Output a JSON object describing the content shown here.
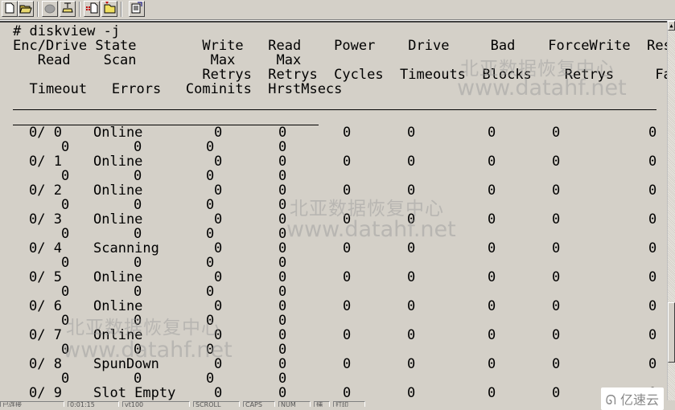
{
  "toolbar": {
    "buttons": [
      {
        "name": "new-icon"
      },
      {
        "name": "open-folder-icon"
      },
      {
        "name": "disconnect-phone-icon"
      },
      {
        "name": "connect-phone-icon"
      },
      {
        "name": "new-session-icon"
      },
      {
        "name": "open-session-icon"
      },
      {
        "name": "properties-icon"
      }
    ]
  },
  "terminal": {
    "command": "# diskview -j",
    "header_lines": [
      "Enc/Drive State        Write   Read    Power    Drive     Bad    ForceWrite  Reset",
      "   Read    Scan         Max     Max",
      "                       Retrys  Retrys  Cycles  Timeouts  Blocks    Retrys     Fail",
      "  Timeout   Errors   Cominits  HrstMsecs"
    ],
    "rows": [
      {
        "drive": "0/ 0",
        "state": "Online",
        "write_max_retrys": "0",
        "read_max_retrys": "0",
        "power_cycles": "0",
        "drive_timeouts": "0",
        "bad_blocks": "0",
        "forcewrite_retrys": "0",
        "reset_fail": "0",
        "read_timeout": "0",
        "scan_errors": "0",
        "cominits": "0",
        "hrstmsecs": "0"
      },
      {
        "drive": "0/ 1",
        "state": "Online",
        "write_max_retrys": "0",
        "read_max_retrys": "0",
        "power_cycles": "0",
        "drive_timeouts": "0",
        "bad_blocks": "0",
        "forcewrite_retrys": "0",
        "reset_fail": "0",
        "read_timeout": "0",
        "scan_errors": "0",
        "cominits": "0",
        "hrstmsecs": "0"
      },
      {
        "drive": "0/ 2",
        "state": "Online",
        "write_max_retrys": "0",
        "read_max_retrys": "0",
        "power_cycles": "0",
        "drive_timeouts": "0",
        "bad_blocks": "0",
        "forcewrite_retrys": "0",
        "reset_fail": "0",
        "read_timeout": "0",
        "scan_errors": "0",
        "cominits": "0",
        "hrstmsecs": "0"
      },
      {
        "drive": "0/ 3",
        "state": "Online",
        "write_max_retrys": "0",
        "read_max_retrys": "0",
        "power_cycles": "0",
        "drive_timeouts": "0",
        "bad_blocks": "0",
        "forcewrite_retrys": "0",
        "reset_fail": "0",
        "read_timeout": "0",
        "scan_errors": "0",
        "cominits": "0",
        "hrstmsecs": "0"
      },
      {
        "drive": "0/ 4",
        "state": "Scanning",
        "write_max_retrys": "0",
        "read_max_retrys": "0",
        "power_cycles": "0",
        "drive_timeouts": "0",
        "bad_blocks": "0",
        "forcewrite_retrys": "0",
        "reset_fail": "0",
        "read_timeout": "0",
        "scan_errors": "0",
        "cominits": "0",
        "hrstmsecs": "0"
      },
      {
        "drive": "0/ 5",
        "state": "Online",
        "write_max_retrys": "0",
        "read_max_retrys": "0",
        "power_cycles": "0",
        "drive_timeouts": "0",
        "bad_blocks": "0",
        "forcewrite_retrys": "0",
        "reset_fail": "0",
        "read_timeout": "0",
        "scan_errors": "0",
        "cominits": "0",
        "hrstmsecs": "0"
      },
      {
        "drive": "0/ 6",
        "state": "Online",
        "write_max_retrys": "0",
        "read_max_retrys": "0",
        "power_cycles": "0",
        "drive_timeouts": "0",
        "bad_blocks": "0",
        "forcewrite_retrys": "0",
        "reset_fail": "0",
        "read_timeout": "0",
        "scan_errors": "0",
        "cominits": "0",
        "hrstmsecs": "0"
      },
      {
        "drive": "0/ 7",
        "state": "Online",
        "write_max_retrys": "0",
        "read_max_retrys": "0",
        "power_cycles": "0",
        "drive_timeouts": "0",
        "bad_blocks": "0",
        "forcewrite_retrys": "0",
        "reset_fail": "0",
        "read_timeout": "0",
        "scan_errors": "0",
        "cominits": "0",
        "hrstmsecs": "0"
      },
      {
        "drive": "0/ 8",
        "state": "SpunDown",
        "write_max_retrys": "0",
        "read_max_retrys": "0",
        "power_cycles": "0",
        "drive_timeouts": "0",
        "bad_blocks": "0",
        "forcewrite_retrys": "0",
        "reset_fail": "0",
        "read_timeout": "0",
        "scan_errors": "0",
        "cominits": "0",
        "hrstmsecs": "0"
      },
      {
        "drive": "0/ 9",
        "state": "Slot Empty",
        "write_max_retrys": "0",
        "read_max_retrys": "0",
        "power_cycles": "0",
        "drive_timeouts": "0",
        "bad_blocks": "0",
        "forcewrite_retrys": "0",
        "reset_fail": "0"
      }
    ]
  },
  "watermarks": {
    "cn_text": "北亚数据恢复中心",
    "url_text": "www.datahf.net",
    "brand": "亿速云"
  },
  "statusbar": {
    "panels": [
      "已连接",
      "0:01:15",
      "vt100",
      "SCROLL",
      "CAPS",
      "NUM",
      "捕",
      "打印"
    ]
  }
}
